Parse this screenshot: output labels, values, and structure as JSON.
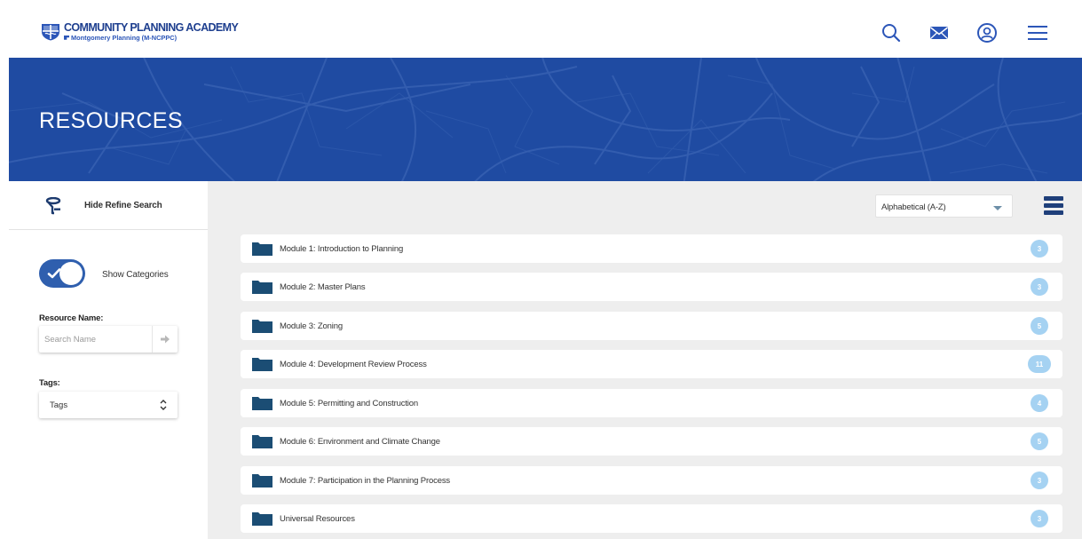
{
  "header": {
    "logo_title": "COMMUNITY PLANNING ACADEMY",
    "logo_subtitle": "Montgomery Planning  (M-NCPPC)",
    "icons": [
      "search-icon",
      "mail-icon",
      "user-circle-icon",
      "menu-icon"
    ]
  },
  "hero": {
    "title": "RESOURCES"
  },
  "sidebar": {
    "refine_label": "Hide Refine Search",
    "toggle_label": "Show Categories",
    "toggle_on": true,
    "resource_name_label": "Resource Name:",
    "search_placeholder": "Search Name",
    "search_value": "",
    "tags_label": "Tags:",
    "tags_value": "Tags"
  },
  "main": {
    "sort_value": "Alphabetical (A-Z)",
    "modules": [
      {
        "name": "Module 1: Introduction to Planning",
        "count": "3"
      },
      {
        "name": "Module 2: Master Plans",
        "count": "3"
      },
      {
        "name": "Module 3: Zoning",
        "count": "5"
      },
      {
        "name": "Module 4: Development Review Process",
        "count": "11"
      },
      {
        "name": "Module 5: Permitting and Construction",
        "count": "4"
      },
      {
        "name": "Module 6: Environment and Climate Change",
        "count": "5"
      },
      {
        "name": "Module 7: Participation in the Planning Process",
        "count": "3"
      },
      {
        "name": "Universal Resources",
        "count": "3"
      }
    ]
  },
  "colors": {
    "brand_blue": "#1f4ba2",
    "toggle_blue": "#2f5fae",
    "folder_navy": "#1b4d74",
    "badge_blue": "#a5d2f2",
    "main_bg": "#eeeeee"
  }
}
